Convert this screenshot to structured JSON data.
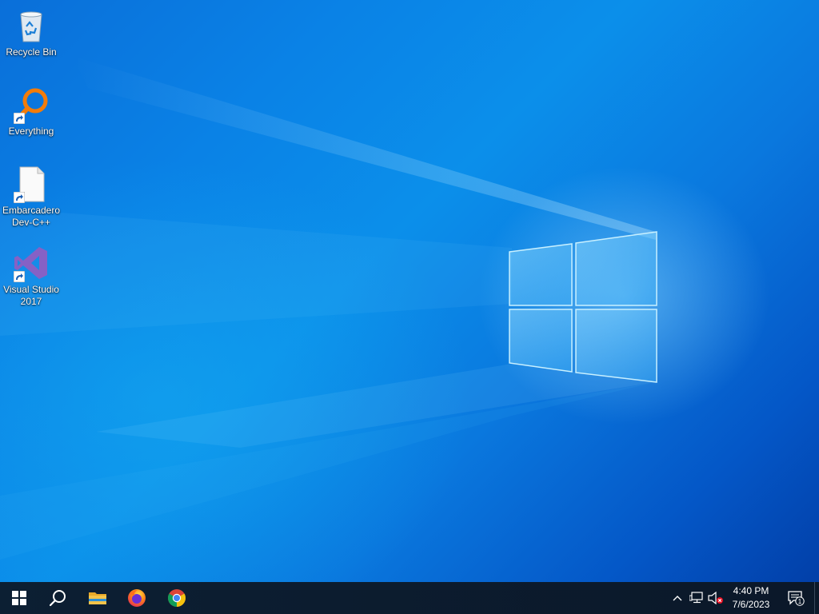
{
  "desktop": {
    "icons": [
      {
        "label": "Recycle Bin",
        "icon": "recycle-bin-icon"
      },
      {
        "label": "Everything",
        "icon": "everything-search-icon"
      },
      {
        "label": "Embarcadero Dev-C++",
        "icon": "file-icon"
      },
      {
        "label": "Visual Studio 2017",
        "icon": "visual-studio-icon"
      }
    ]
  },
  "taskbar": {
    "pinned": [
      {
        "name": "start",
        "icon": "windows-logo-icon"
      },
      {
        "name": "search",
        "icon": "search-icon"
      },
      {
        "name": "file-explorer",
        "icon": "folder-icon"
      },
      {
        "name": "firefox",
        "icon": "firefox-icon"
      },
      {
        "name": "chrome",
        "icon": "chrome-icon"
      }
    ],
    "tray": {
      "chevron_icon": "chevron-up-icon",
      "network_icon": "network-icon",
      "volume_icon": "volume-muted-icon",
      "time": "4:40 PM",
      "date": "7/6/2023",
      "notification_count": "1"
    }
  },
  "colors": {
    "desktop_blue": "#0a82e6",
    "taskbar": "#0b1829",
    "folder_yellow": "#f3c34a",
    "vs_purple": "#8661c5",
    "everything_orange": "#f27c0a"
  }
}
